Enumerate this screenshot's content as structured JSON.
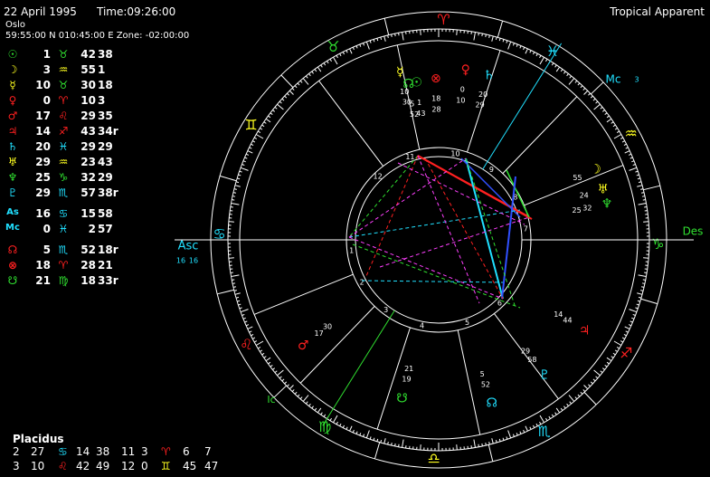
{
  "header": {
    "date": "22 April 1995",
    "time": "Time:09:26:00",
    "place": "Oslo",
    "coords": "59:55:00 N 010:45:00 E Zone: -02:00:00",
    "mode": "Tropical Apparent"
  },
  "colors": {
    "red": "#ff2020",
    "green": "#30e030",
    "yellow": "#ffff20",
    "cyan": "#20e0ff",
    "white": "#ffffff"
  },
  "planets": [
    {
      "glyph": "☉",
      "gcolor": "#30e030",
      "deg": "1",
      "sign": "♉",
      "scolor": "#30e030",
      "min": "42",
      "rest": "38"
    },
    {
      "glyph": "☽",
      "gcolor": "#ffff20",
      "deg": "3",
      "sign": "♒",
      "scolor": "#ffff20",
      "min": "55",
      "rest": "1"
    },
    {
      "glyph": "☿",
      "gcolor": "#ffff20",
      "deg": "10",
      "sign": "♉",
      "scolor": "#30e030",
      "min": "30",
      "rest": "18"
    },
    {
      "glyph": "♀",
      "gcolor": "#ff2020",
      "deg": "0",
      "sign": "♈",
      "scolor": "#ff2020",
      "min": "10",
      "rest": "3"
    },
    {
      "glyph": "♂",
      "gcolor": "#ff2020",
      "deg": "17",
      "sign": "♌",
      "scolor": "#ff2020",
      "min": "29",
      "rest": "35"
    },
    {
      "glyph": "♃",
      "gcolor": "#ff2020",
      "deg": "14",
      "sign": "♐",
      "scolor": "#ff2020",
      "min": "43",
      "rest": "34r"
    },
    {
      "glyph": "♄",
      "gcolor": "#20e0ff",
      "deg": "20",
      "sign": "♓",
      "scolor": "#20e0ff",
      "min": "29",
      "rest": "29"
    },
    {
      "glyph": "♅",
      "gcolor": "#ffff20",
      "deg": "29",
      "sign": "♒",
      "scolor": "#ffff20",
      "min": "23",
      "rest": "43"
    },
    {
      "glyph": "♆",
      "gcolor": "#30e030",
      "deg": "25",
      "sign": "♑",
      "scolor": "#30e030",
      "min": "32",
      "rest": "29"
    },
    {
      "glyph": "♇",
      "gcolor": "#20e0ff",
      "deg": "29",
      "sign": "♏",
      "scolor": "#20e0ff",
      "min": "57",
      "rest": "38r"
    }
  ],
  "angles": [
    {
      "glyph": "As",
      "gcolor": "#20e0ff",
      "deg": "16",
      "sign": "♋",
      "scolor": "#20e0ff",
      "min": "15",
      "rest": "58"
    },
    {
      "glyph": "Mc",
      "gcolor": "#20e0ff",
      "deg": "0",
      "sign": "♓",
      "scolor": "#20e0ff",
      "min": "2",
      "rest": "57"
    }
  ],
  "points": [
    {
      "glyph": "☊",
      "gcolor": "#ff2020",
      "deg": "5",
      "sign": "♏",
      "scolor": "#20e0ff",
      "min": "52",
      "rest": "18r"
    },
    {
      "glyph": "⊗",
      "gcolor": "#ff2020",
      "deg": "18",
      "sign": "♈",
      "scolor": "#ff2020",
      "min": "28",
      "rest": "21"
    },
    {
      "glyph": "☋",
      "gcolor": "#30e030",
      "deg": "21",
      "sign": "♍",
      "scolor": "#30e030",
      "min": "18",
      "rest": "33r"
    }
  ],
  "houses": {
    "title": "Placidus",
    "row1": [
      {
        "t": "2",
        "c": "#ffffff"
      },
      {
        "t": "27",
        "c": "#ffffff"
      },
      {
        "t": "♋",
        "c": "#20e0ff"
      },
      {
        "t": "14",
        "c": "#ffffff"
      },
      {
        "t": "38",
        "c": "#ffffff"
      },
      {
        "t": "11",
        "c": "#ffffff"
      },
      {
        "t": "3",
        "c": "#ffffff"
      },
      {
        "t": "♈",
        "c": "#ff2020"
      },
      {
        "t": "6",
        "c": "#ffffff"
      },
      {
        "t": "7",
        "c": "#ffffff"
      }
    ],
    "row2": [
      {
        "t": "3",
        "c": "#ffffff"
      },
      {
        "t": "10",
        "c": "#ffffff"
      },
      {
        "t": "♌",
        "c": "#ff2020"
      },
      {
        "t": "42",
        "c": "#ffffff"
      },
      {
        "t": "49",
        "c": "#ffffff"
      },
      {
        "t": "12",
        "c": "#ffffff"
      },
      {
        "t": "0",
        "c": "#ffffff"
      },
      {
        "t": "♊",
        "c": "#ffff20"
      },
      {
        "t": "45",
        "c": "#ffffff"
      },
      {
        "t": "47",
        "c": "#ffffff"
      }
    ]
  },
  "wheel": {
    "asc": "Asc",
    "asc_deg": "16",
    "asc_min": "16",
    "des": "Des",
    "mc": "Mc",
    "mc_num": "3",
    "ic": "Ic",
    "zodiac": [
      {
        "g": "♈",
        "c": "#ff2020"
      },
      {
        "g": "♉",
        "c": "#30e030"
      },
      {
        "g": "♊",
        "c": "#ffff20"
      },
      {
        "g": "♋",
        "c": "#20e0ff"
      },
      {
        "g": "♌",
        "c": "#ff2020"
      },
      {
        "g": "♍",
        "c": "#30e030"
      },
      {
        "g": "♎",
        "c": "#ffff20"
      },
      {
        "g": "♏",
        "c": "#20e0ff"
      },
      {
        "g": "♐",
        "c": "#ff2020"
      },
      {
        "g": "♑",
        "c": "#30e030"
      },
      {
        "g": "♒",
        "c": "#ffff20"
      },
      {
        "g": "♓",
        "c": "#20e0ff"
      }
    ],
    "house_numbers": [
      "1",
      "2",
      "3",
      "4",
      "5",
      "6",
      "7",
      "8",
      "9",
      "10",
      "11",
      "12"
    ],
    "wheel_planets": [
      {
        "g": "☿",
        "c": "#ffff20",
        "d": "10",
        "m": "30"
      },
      {
        "g": "☊",
        "c": "#30e030",
        "d": "5",
        "m": "52"
      },
      {
        "g": "☉",
        "c": "#30e030",
        "d": "1",
        "m": "43"
      },
      {
        "g": "⊗",
        "c": "#ff2020",
        "d": "18",
        "m": "28"
      },
      {
        "g": "♀",
        "c": "#ff2020",
        "d": "0",
        "m": "10"
      },
      {
        "g": "♄",
        "c": "#20e0ff",
        "d": "20",
        "m": "29"
      },
      {
        "g": "☽",
        "c": "#ffff20",
        "d": "55",
        "m": ""
      },
      {
        "g": "♅",
        "c": "#ffff20",
        "d": "24",
        "m": ""
      },
      {
        "g": "♆",
        "c": "#30e030",
        "d": "32",
        "m": "25"
      },
      {
        "g": "♃",
        "c": "#ff2020",
        "d": "44",
        "m": "14"
      },
      {
        "g": "♇",
        "c": "#20e0ff",
        "d": "58",
        "m": "29"
      },
      {
        "g": "☊",
        "c": "#20e0ff",
        "d": "52",
        "m": "5"
      },
      {
        "g": "☋",
        "c": "#30e030",
        "d": "19",
        "m": "21"
      },
      {
        "g": "♂",
        "c": "#ff2020",
        "d": "17",
        "m": "30"
      }
    ]
  }
}
